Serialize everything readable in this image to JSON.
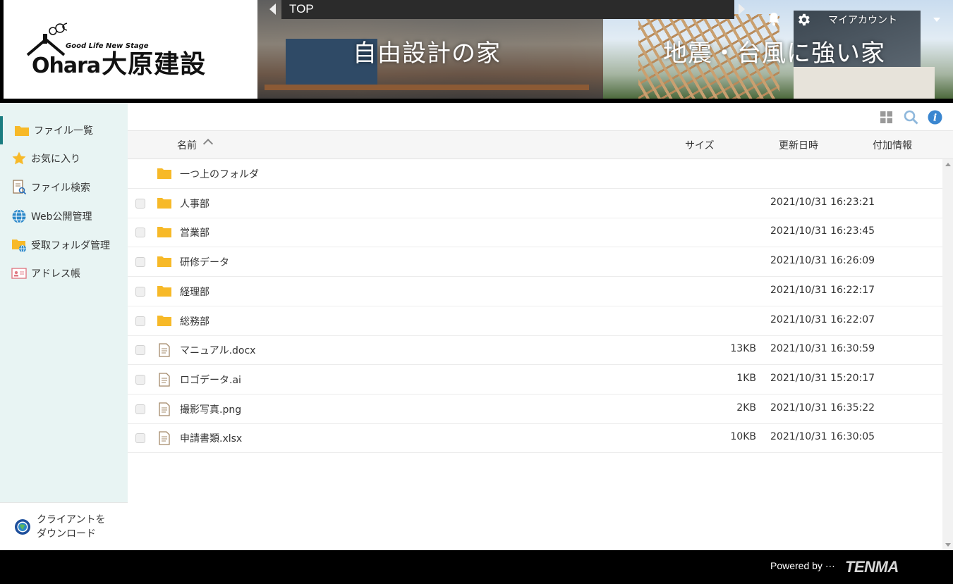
{
  "header": {
    "logo_brand": "Ohara",
    "logo_jp": "大原建設",
    "logo_tagline": "Good Life  New Stage",
    "banner_caption_left": "自由設計の家",
    "banner_caption_right": "地震・台風に強い家",
    "breadcrumb": "TOP",
    "account_label": "マイアカウント"
  },
  "sidebar": {
    "items": [
      {
        "label": "ファイル一覧",
        "icon": "folder-icon"
      },
      {
        "label": "お気に入り",
        "icon": "star-icon"
      },
      {
        "label": "ファイル検索",
        "icon": "file-search-icon"
      },
      {
        "label": "Web公開管理",
        "icon": "globe-icon"
      },
      {
        "label": "受取フォルダ管理",
        "icon": "shared-folder-icon"
      },
      {
        "label": "アドレス帳",
        "icon": "address-book-icon"
      }
    ],
    "client_download": "クライアントを\nダウンロード"
  },
  "columns": {
    "name": "名前",
    "size": "サイズ",
    "modified": "更新日時",
    "extra": "付加情報"
  },
  "files": [
    {
      "name": "一つ上のフォルダ",
      "type": "folder",
      "size": "",
      "date": ""
    },
    {
      "name": "人事部",
      "type": "folder",
      "size": "",
      "date": "2021/10/31 16:23:21"
    },
    {
      "name": "営業部",
      "type": "folder",
      "size": "",
      "date": "2021/10/31 16:23:45"
    },
    {
      "name": "研修データ",
      "type": "folder",
      "size": "",
      "date": "2021/10/31 16:26:09"
    },
    {
      "name": "経理部",
      "type": "folder",
      "size": "",
      "date": "2021/10/31 16:22:17"
    },
    {
      "name": "総務部",
      "type": "folder",
      "size": "",
      "date": "2021/10/31 16:22:07"
    },
    {
      "name": "マニュアル.docx",
      "type": "file",
      "size": "13KB",
      "date": "2021/10/31 16:30:59"
    },
    {
      "name": "ロゴデータ.ai",
      "type": "file",
      "size": "1KB",
      "date": "2021/10/31 15:20:17"
    },
    {
      "name": "撮影写真.png",
      "type": "file",
      "size": "2KB",
      "date": "2021/10/31 16:35:22"
    },
    {
      "name": "申請書類.xlsx",
      "type": "file",
      "size": "10KB",
      "date": "2021/10/31 16:30:05"
    }
  ],
  "footer": {
    "powered_by": "Powered by ···",
    "vendor": "TENMA"
  },
  "colors": {
    "sidebar_bg": "#e8f4f3",
    "active_accent": "#1a7c80",
    "folder": "#f7b928",
    "footer_bg": "#000000"
  }
}
